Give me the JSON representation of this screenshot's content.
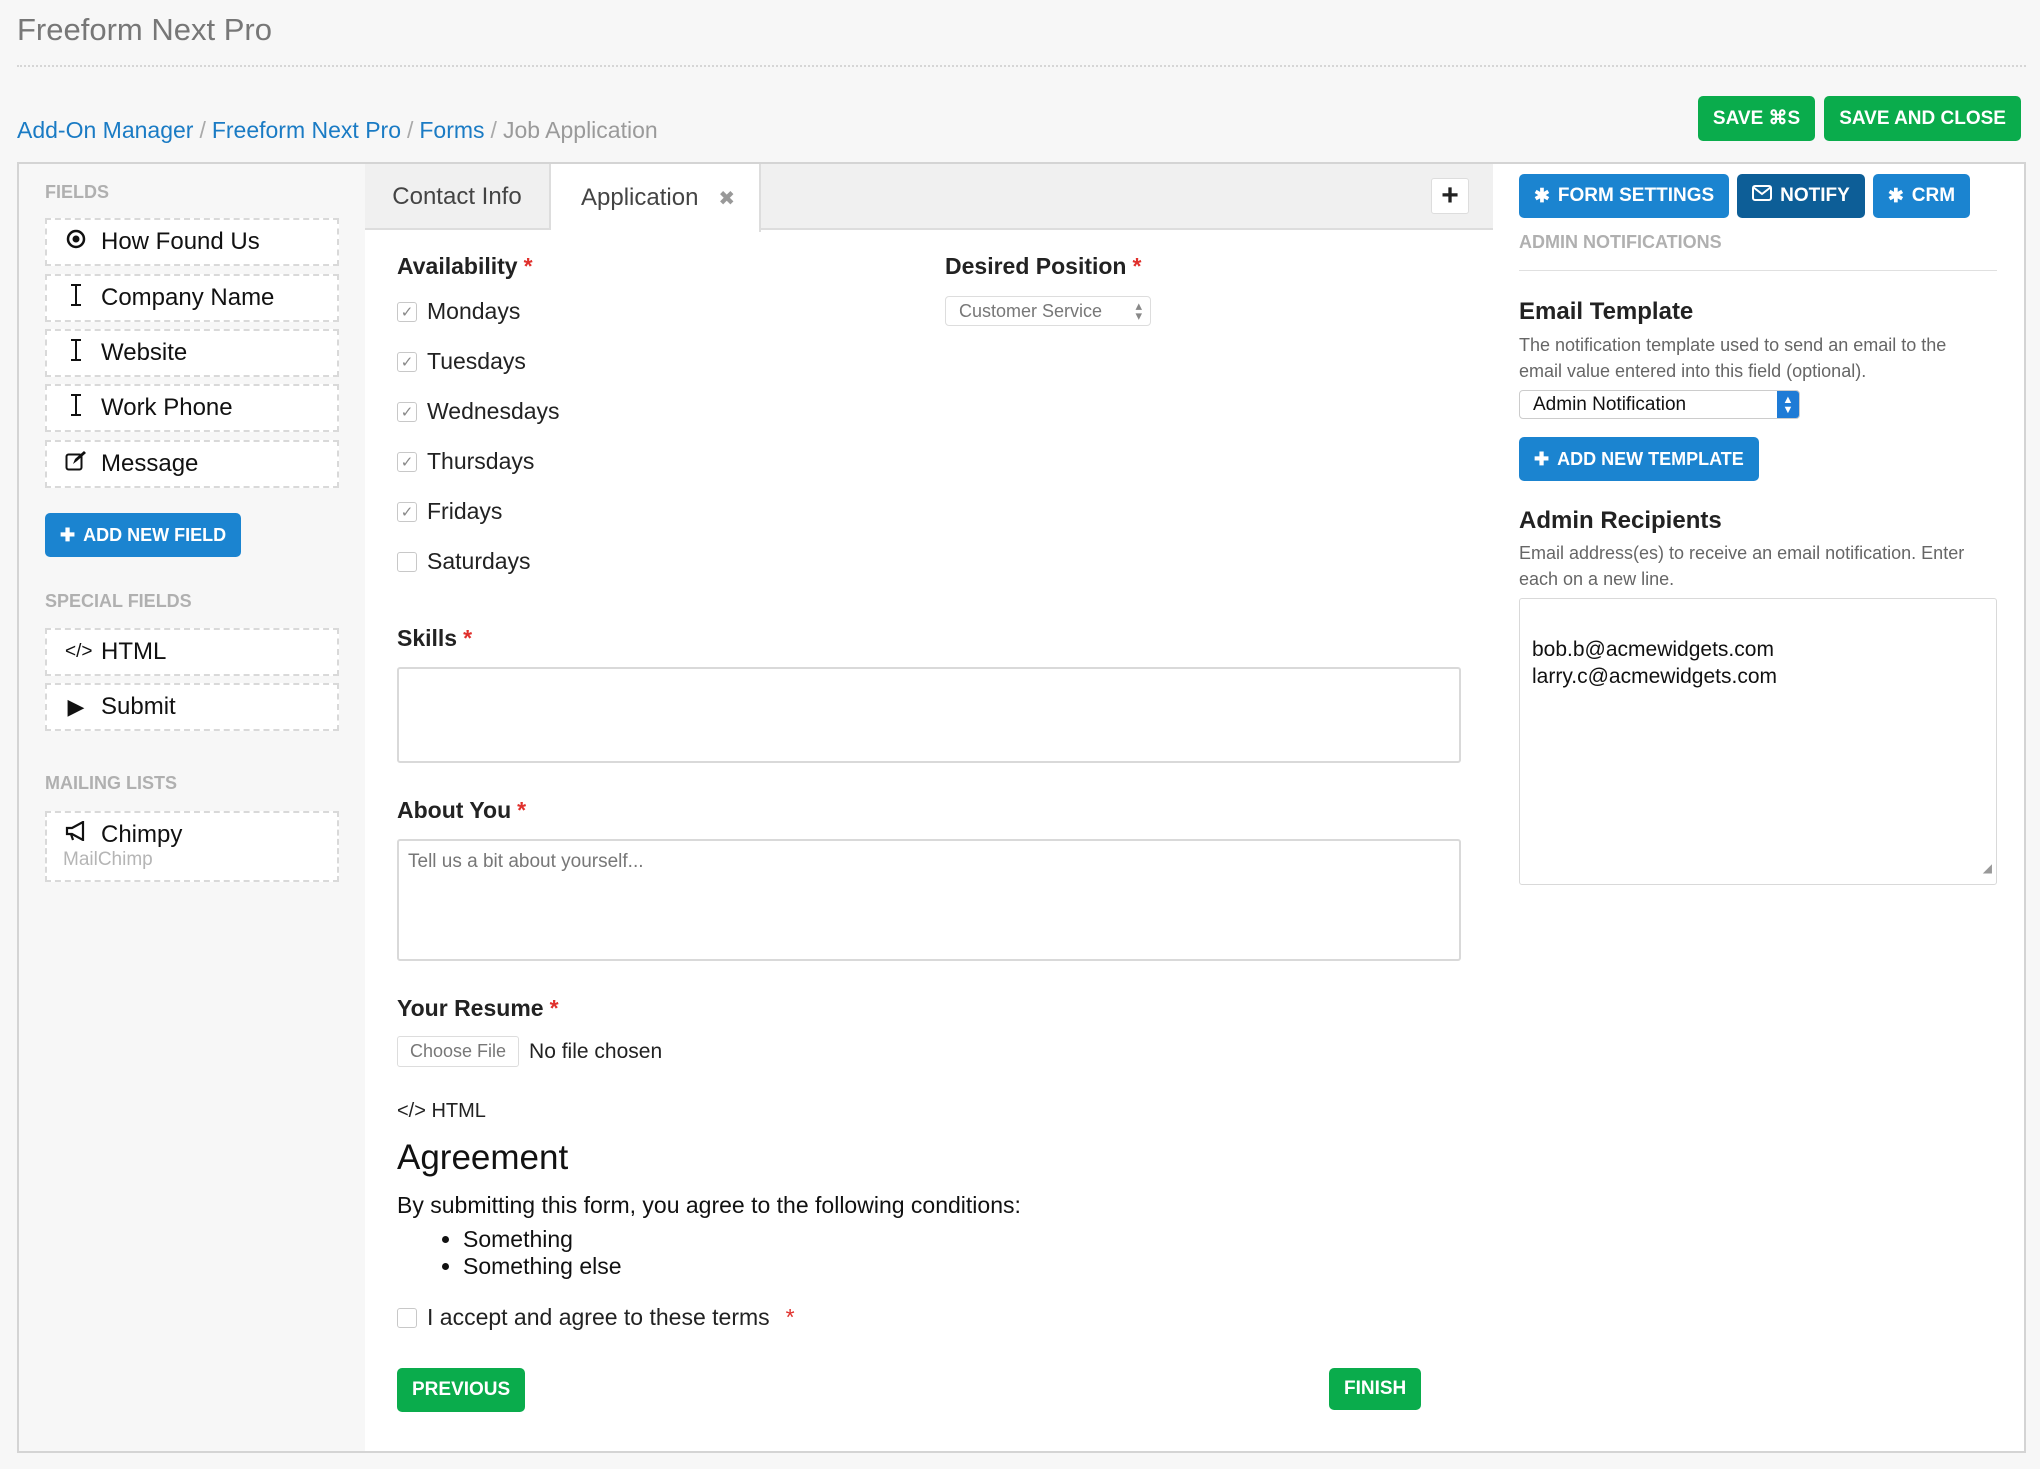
{
  "app": {
    "title": "Freeform Next Pro"
  },
  "breadcrumb": {
    "items": [
      "Add-On Manager",
      "Freeform Next Pro",
      "Forms"
    ],
    "current": "Job Application",
    "separator": "/"
  },
  "actions": {
    "save": "SAVE ⌘S",
    "save_close": "SAVE AND CLOSE"
  },
  "left": {
    "fields_label": "FIELDS",
    "fields": [
      {
        "label": "How Found Us",
        "icon": "radio-icon"
      },
      {
        "label": "Company Name",
        "icon": "text-cursor-icon"
      },
      {
        "label": "Website",
        "icon": "text-cursor-icon"
      },
      {
        "label": "Work Phone",
        "icon": "text-cursor-icon"
      },
      {
        "label": "Message",
        "icon": "edit-icon"
      }
    ],
    "add_field": "ADD NEW FIELD",
    "special_label": "SPECIAL FIELDS",
    "special": [
      {
        "label": "HTML",
        "icon": "code-icon"
      },
      {
        "label": "Submit",
        "icon": "play-icon"
      }
    ],
    "mailing_label": "MAILING LISTS",
    "mailing": [
      {
        "label": "Chimpy",
        "sub": "MailChimp",
        "icon": "megaphone-icon"
      }
    ]
  },
  "tabs": {
    "items": [
      {
        "label": "Contact Info"
      },
      {
        "label": "Application"
      }
    ],
    "add": "+"
  },
  "form": {
    "availability": {
      "label": "Availability",
      "options": [
        {
          "label": "Mondays",
          "checked": true
        },
        {
          "label": "Tuesdays",
          "checked": true
        },
        {
          "label": "Wednesdays",
          "checked": true
        },
        {
          "label": "Thursdays",
          "checked": true
        },
        {
          "label": "Fridays",
          "checked": true
        },
        {
          "label": "Saturdays",
          "checked": false
        }
      ]
    },
    "position": {
      "label": "Desired Position",
      "value": "Customer Service"
    },
    "skills": {
      "label": "Skills",
      "value": ""
    },
    "about": {
      "label": "About You",
      "placeholder": "Tell us a bit about yourself..."
    },
    "resume": {
      "label": "Your Resume",
      "button": "Choose File",
      "status": "No file chosen"
    },
    "html_label": "HTML",
    "agreement": {
      "title": "Agreement",
      "text": "By submitting this form, you agree to the following conditions:",
      "items": [
        "Something",
        "Something else"
      ],
      "accept": "I accept and agree to these terms"
    },
    "required_mark": "*",
    "previous": "PREVIOUS",
    "finish": "FINISH"
  },
  "right": {
    "tabs": {
      "form_settings": "FORM SETTINGS",
      "notify": "NOTIFY",
      "crm": "CRM"
    },
    "section": "ADMIN NOTIFICATIONS",
    "email_template": {
      "title": "Email Template",
      "desc": "The notification template used to send an email to the email value entered into this field (optional).",
      "value": "Admin Notification",
      "add": "ADD NEW TEMPLATE"
    },
    "recipients": {
      "title": "Admin Recipients",
      "desc": "Email address(es) to receive an email notification. Enter each on a new line.",
      "value": "bob.b@acmewidgets.com\nlarry.c@acmewidgets.com"
    }
  },
  "colors": {
    "green": "#0aac4c",
    "blue": "#1b84d0",
    "dark_blue": "#0d5e97",
    "required": "#e0302c",
    "link": "#1a7bc4"
  }
}
